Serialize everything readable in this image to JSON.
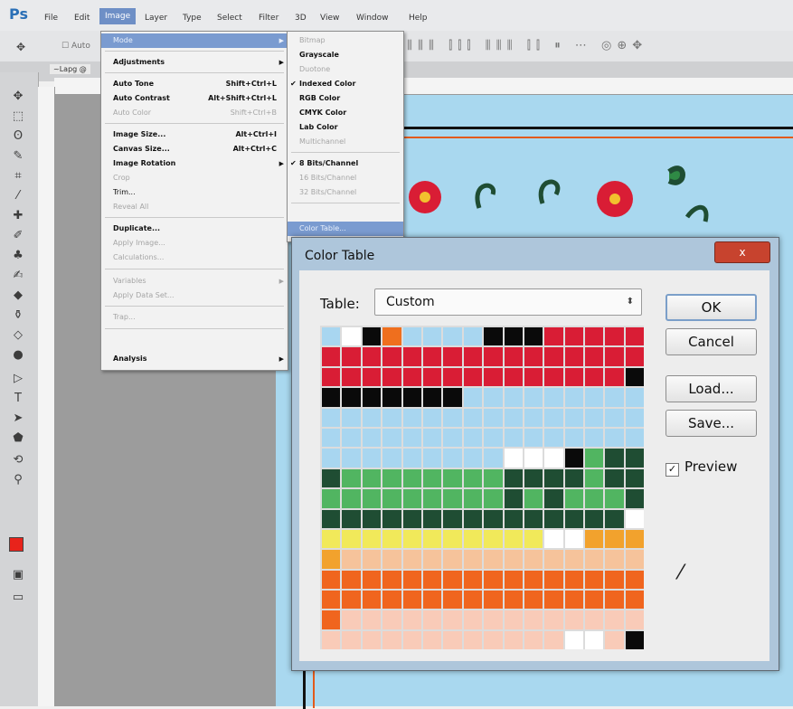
{
  "app": {
    "logo": "Ps"
  },
  "menubar": {
    "items": [
      "File",
      "Edit",
      "Image",
      "Layer",
      "Type",
      "Select",
      "Filter",
      "3D",
      "View",
      "Window",
      "Help"
    ],
    "active": "Image"
  },
  "options_bar": {
    "auto_select_label": "Auto"
  },
  "document_tab": {
    "label": "~Lapg @"
  },
  "image_menu": {
    "items": [
      {
        "label": "Mode",
        "submenu": true,
        "highlight": true
      },
      {
        "label": "Adjustments",
        "submenu": true
      },
      {
        "label": "Auto Tone",
        "shortcut": "Shift+Ctrl+L"
      },
      {
        "label": "Auto Contrast",
        "shortcut": "Alt+Shift+Ctrl+L"
      },
      {
        "label": "Auto Color",
        "shortcut": "Shift+Ctrl+B",
        "disabled": true
      },
      {
        "label": "Image Size...",
        "shortcut": "Alt+Ctrl+I"
      },
      {
        "label": "Canvas Size...",
        "shortcut": "Alt+Ctrl+C"
      },
      {
        "label": "Image Rotation",
        "submenu": true
      },
      {
        "label": "Crop",
        "disabled": true
      },
      {
        "label": "Trim..."
      },
      {
        "label": "Reveal All",
        "disabled": true
      },
      {
        "label": "Duplicate..."
      },
      {
        "label": "Apply Image...",
        "disabled": true
      },
      {
        "label": "Calculations...",
        "disabled": true
      },
      {
        "label": "Variables",
        "submenu": true,
        "disabled": true
      },
      {
        "label": "Apply Data Set...",
        "disabled": true
      },
      {
        "label": "Trap...",
        "disabled": true
      },
      {
        "label": "Analysis",
        "submenu": true
      }
    ]
  },
  "mode_menu": {
    "items": [
      {
        "label": "Bitmap",
        "disabled": true
      },
      {
        "label": "Grayscale"
      },
      {
        "label": "Duotone",
        "disabled": true
      },
      {
        "label": "Indexed Color",
        "checked": true
      },
      {
        "label": "RGB Color"
      },
      {
        "label": "CMYK Color"
      },
      {
        "label": "Lab Color"
      },
      {
        "label": "Multichannel",
        "disabled": true
      },
      {
        "label": "8 Bits/Channel",
        "checked": true
      },
      {
        "label": "16 Bits/Channel",
        "disabled": true
      },
      {
        "label": "32 Bits/Channel",
        "disabled": true
      },
      {
        "label": "Color Table...",
        "highlight": true
      }
    ]
  },
  "dialog": {
    "title": "Color Table",
    "close_label": "x",
    "table_label": "Table:",
    "table_value": "Custom",
    "ok_label": "OK",
    "cancel_label": "Cancel",
    "load_label": "Load...",
    "save_label": "Save...",
    "preview_label": "Preview",
    "preview_checked": true,
    "palette_key": {
      "A": "#a8d6f0",
      "W": "#ffffff",
      "K": "#0a0a0a",
      "O": "#ef6f1e",
      "R": "#d91d35",
      "G": "#51b561",
      "D": "#1f4d33",
      "Y": "#f1e95a",
      "T": "#f2a22d",
      "P": "#f6c39b",
      "E": "#f0651e",
      "S": "#f9cbb8"
    },
    "palette_rows": [
      "AWKOAAAAKKKRRRRR",
      "RRRRRRRRRRRRRRRR",
      "RRRRRRRRRRRRRRRK",
      "KKKKKKKAAAAAAAAA",
      "AAAAAAAAAAAAAAAA",
      "AAAAAAAAAAAAAAAA",
      "AAAAAAAAAWWWKGDD",
      "DGGGGGGGGDDDDGDD",
      "GGGGGGGGGDGDGGGD",
      "DDDDDDDDDDDDDDDW",
      "YYYYYYYYYYYWWTTT",
      "TPPPPPPPPPPPPPPP",
      "EEEEEEEEEEEEEEEE",
      "EEEEEEEEEEEEEEEE",
      "ESSSSSSSSSSSSSSS",
      "SSSSSSSSSSSSWWSK"
    ]
  }
}
